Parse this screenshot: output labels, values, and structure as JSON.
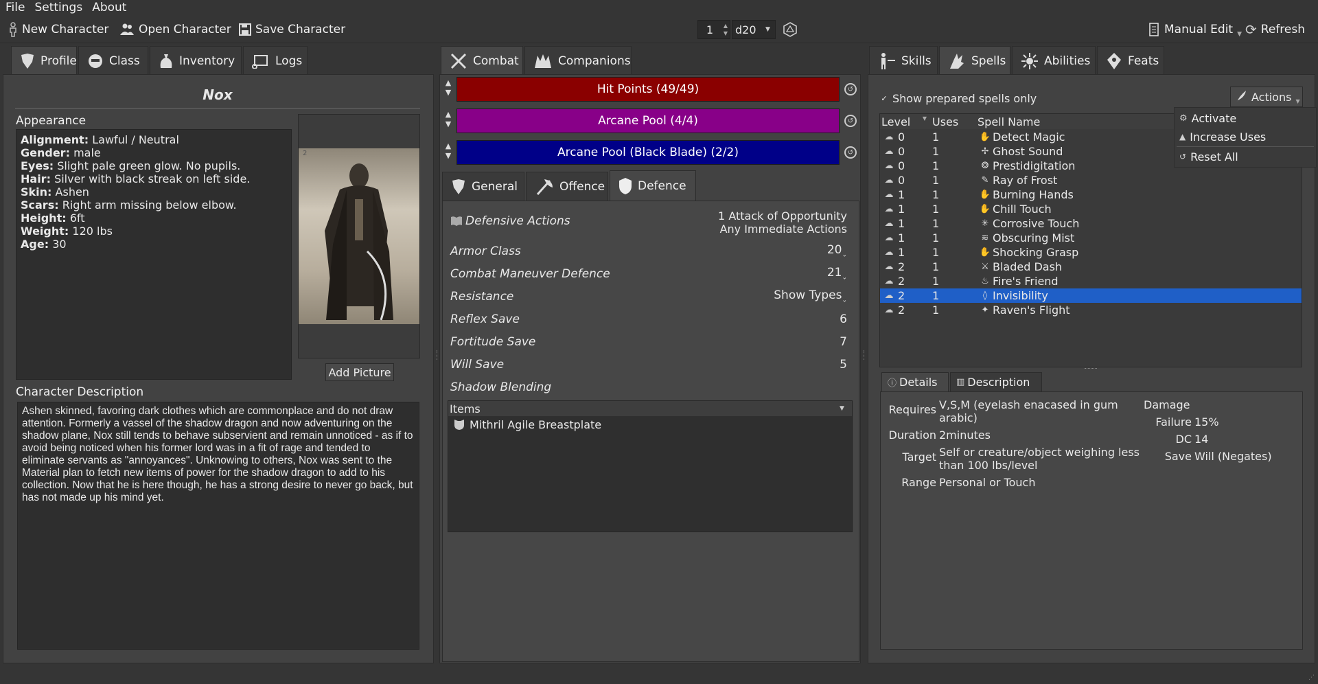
{
  "menubar": [
    "File",
    "Settings",
    "About"
  ],
  "toolbar": {
    "new_character": "New Character",
    "open_character": "Open Character",
    "save_character": "Save Character",
    "dice_count": "1",
    "dice_type": "d20",
    "manual_edit": "Manual Edit",
    "refresh": "Refresh"
  },
  "left_tabs": [
    "Profile",
    "Class",
    "Inventory",
    "Logs"
  ],
  "profile": {
    "name": "Nox",
    "appearance_label": "Appearance",
    "appearance": [
      {
        "key": "Alignment:",
        "value": "Lawful / Neutral"
      },
      {
        "key": "Gender:",
        "value": "male"
      },
      {
        "key": "Eyes:",
        "value": "Slight pale green glow. No pupils."
      },
      {
        "key": "Hair:",
        "value": "Silver with black streak on left side."
      },
      {
        "key": "Skin:",
        "value": "Ashen"
      },
      {
        "key": "Scars:",
        "value": "Right arm missing below elbow."
      },
      {
        "key": "Height:",
        "value": "6ft"
      },
      {
        "key": "Weight:",
        "value": "120 lbs"
      },
      {
        "key": "Age:",
        "value": "30"
      }
    ],
    "picture_index": "2",
    "add_picture": "Add Picture",
    "description_label": "Character Description",
    "description": "Ashen skinned, favoring dark clothes which are commonplace and do not draw attention. Formerly a vassel of the shadow dragon and now adventuring on the shadow plane, Nox still tends to behave subservient and remain unnoticed - as if to avoid being noticed when his former lord was in a fit of rage and tended to eliminate servants as  \"annoyances\". Unknowing to others, Nox was sent to the Material plan to fetch new items of power for the shadow dragon to add to his collection. Now that he is here though, he has a strong desire to never go back, but has not made up his mind yet."
  },
  "middle_tabs": [
    "Combat",
    "Companions"
  ],
  "pools": [
    {
      "label": "Hit Points   (49/49)",
      "color": "#8a0000"
    },
    {
      "label": "Arcane Pool   (4/4)",
      "color": "#880088"
    },
    {
      "label": "Arcane Pool (Black Blade)   (2/2)",
      "color": "#000088"
    }
  ],
  "combat_subtabs": [
    "General",
    "Offence",
    "Defence"
  ],
  "defence": {
    "defensive_actions_label": "Defensive Actions",
    "defensive_actions_value_1": "1 Attack of Opportunity",
    "defensive_actions_value_2": "Any Immediate Actions",
    "rows": [
      {
        "label": "Armor Class",
        "value": "20"
      },
      {
        "label": "Combat Maneuver Defence",
        "value": "21"
      },
      {
        "label": "Resistance",
        "value": "Show Types"
      },
      {
        "label": "Reflex Save",
        "value": "6"
      },
      {
        "label": "Fortitude Save",
        "value": "7"
      },
      {
        "label": "Will Save",
        "value": "5"
      },
      {
        "label": "Shadow Blending",
        "value": ""
      }
    ],
    "items_label": "Items",
    "items": [
      "Mithril Agile Breastplate"
    ]
  },
  "right_tabs": [
    "Skills",
    "Spells",
    "Abilities",
    "Feats"
  ],
  "spells": {
    "show_prepared_label": "Show prepared spells only",
    "actions_label": "Actions",
    "columns": [
      "Level",
      "Uses",
      "Spell Name"
    ],
    "rows": [
      {
        "level": "0",
        "uses": "1",
        "name": "Detect Magic",
        "selected": false
      },
      {
        "level": "0",
        "uses": "1",
        "name": "Ghost Sound",
        "selected": false
      },
      {
        "level": "0",
        "uses": "1",
        "name": "Prestidigitation",
        "selected": false
      },
      {
        "level": "0",
        "uses": "1",
        "name": "Ray of Frost",
        "selected": false
      },
      {
        "level": "1",
        "uses": "1",
        "name": "Burning Hands",
        "selected": false
      },
      {
        "level": "1",
        "uses": "1",
        "name": "Chill Touch",
        "selected": false
      },
      {
        "level": "1",
        "uses": "1",
        "name": "Corrosive Touch",
        "selected": false
      },
      {
        "level": "1",
        "uses": "1",
        "name": "Obscuring Mist",
        "selected": false
      },
      {
        "level": "1",
        "uses": "1",
        "name": "Shocking Grasp",
        "selected": false
      },
      {
        "level": "2",
        "uses": "1",
        "name": "Bladed Dash",
        "selected": false
      },
      {
        "level": "2",
        "uses": "1",
        "name": "Fire's Friend",
        "selected": false
      },
      {
        "level": "2",
        "uses": "1",
        "name": "Invisibility",
        "selected": true
      },
      {
        "level": "2",
        "uses": "1",
        "name": "Raven's Flight",
        "selected": false
      }
    ],
    "actions_menu": [
      "Activate",
      "Increase Uses",
      "Reset All"
    ]
  },
  "details": {
    "tabs": [
      "Details",
      "Description"
    ],
    "requires_label": "Requires",
    "requires_value": "V,S,M (eyelash enacased in gum arabic)",
    "duration_label": "Duration",
    "duration_value": "2minutes",
    "target_label": "Target",
    "target_value": "Self or creature/object weighing less than 100 lbs/level",
    "range_label": "Range",
    "range_value": "Personal or Touch",
    "damage_label": "Damage",
    "failure_label": "Failure",
    "failure_value": "15%",
    "dc_label": "DC",
    "dc_value": "14",
    "save_label": "Save",
    "save_value": "Will (Negates)"
  }
}
